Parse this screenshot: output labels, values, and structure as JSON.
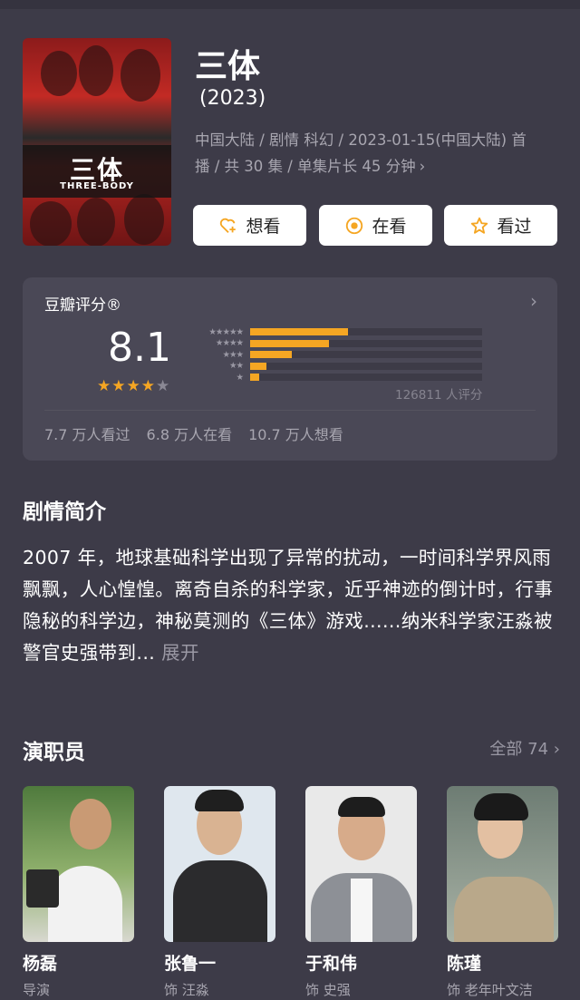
{
  "show": {
    "title": "三体",
    "year": "(2023)",
    "meta_line1": "中国大陆 / 剧情 科幻 / 2023-01-15(中国大陆) 首",
    "meta_line2": "播 / 共 30 集 / 单集片长 45 分钟",
    "poster_title": "三体",
    "poster_subtitle": "THREE-BODY"
  },
  "actions": {
    "want": "想看",
    "watching": "在看",
    "watched": "看过"
  },
  "rating": {
    "label": "豆瓣评分®",
    "score": "8.1",
    "stars_filled": 4,
    "distribution": [
      {
        "stars": "★★★★★",
        "fraction": 0.42
      },
      {
        "stars": "★★★★",
        "fraction": 0.34
      },
      {
        "stars": "★★★",
        "fraction": 0.18
      },
      {
        "stars": "★★",
        "fraction": 0.07
      },
      {
        "stars": "★",
        "fraction": 0.04
      }
    ],
    "count": "126811 人评分",
    "watched_stat": "7.7 万人看过",
    "watching_stat": "6.8 万人在看",
    "want_stat": "10.7 万人想看"
  },
  "synopsis": {
    "heading": "剧情简介",
    "text": "2007 年，地球基础科学出现了异常的扰动，一时间科学界风雨飘飘，人心惶惶。离奇自杀的科学家，近乎神迹的倒计时，行事隐秘的科学边，神秘莫测的《三体》游戏......纳米科学家汪淼被警官史强带到...",
    "more": "展开"
  },
  "cast": {
    "heading": "演职员",
    "all_link": "全部 74",
    "members": [
      {
        "name": "杨磊",
        "role": "导演"
      },
      {
        "name": "张鲁一",
        "role": "饰 汪淼"
      },
      {
        "name": "于和伟",
        "role": "饰 史强"
      },
      {
        "name": "陈瑾",
        "role": "饰 老年叶文洁"
      }
    ]
  },
  "colors": {
    "background": "#3d3b48",
    "card": "#4a4856",
    "accent_star": "#f5a623",
    "muted_text": "#a8a6b0"
  }
}
